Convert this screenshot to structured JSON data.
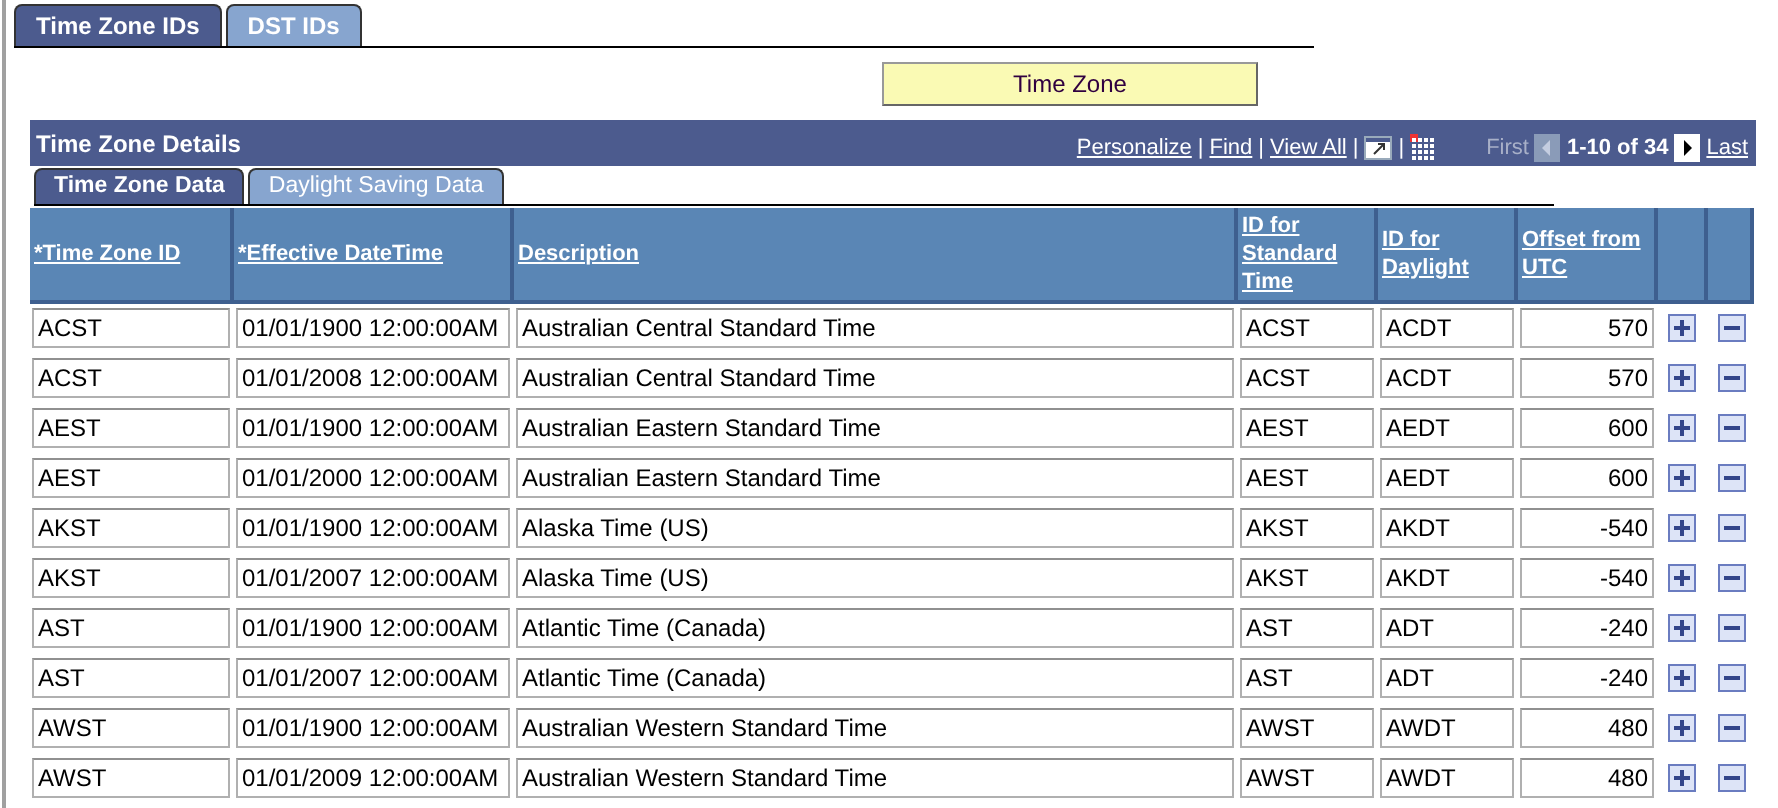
{
  "tabs": [
    {
      "label": "Time Zone IDs",
      "selected": true
    },
    {
      "label": "DST IDs",
      "selected": false
    }
  ],
  "action_button": {
    "label": "Time Zone"
  },
  "section": {
    "title": "Time Zone Details",
    "links": [
      {
        "kind": "link",
        "text": "Personalize"
      },
      {
        "kind": "separator",
        "text": "|"
      },
      {
        "kind": "link",
        "text": "Find"
      },
      {
        "kind": "separator",
        "text": "|"
      },
      {
        "kind": "link",
        "text": "View All"
      },
      {
        "kind": "separator",
        "text": "|"
      },
      {
        "kind": "new-window"
      },
      {
        "kind": "separator",
        "text": "|"
      },
      {
        "kind": "grid"
      }
    ],
    "first": "First",
    "range": "1-10 of 34",
    "last": "Last",
    "prev_disabled": true
  },
  "subtabs": [
    {
      "label": "Time Zone Data",
      "selected": true
    },
    {
      "label": "Daylight Saving Data",
      "selected": false
    }
  ],
  "table": {
    "columns": [
      "*Time Zone ID",
      "*Effective DateTime",
      "Description",
      "ID for Standard Time",
      "ID for Daylight",
      "Offset from UTC"
    ],
    "rows": [
      [
        "ACST",
        "01/01/1900 12:00:00AM",
        "Australian Central Standard Time",
        "ACST",
        "ACDT",
        "570"
      ],
      [
        "ACST",
        "01/01/2008 12:00:00AM",
        "Australian Central Standard Time",
        "ACST",
        "ACDT",
        "570"
      ],
      [
        "AEST",
        "01/01/1900 12:00:00AM",
        "Australian Eastern Standard Time",
        "AEST",
        "AEDT",
        "600"
      ],
      [
        "AEST",
        "01/01/2000 12:00:00AM",
        "Australian Eastern Standard Time",
        "AEST",
        "AEDT",
        "600"
      ],
      [
        "AKST",
        "01/01/1900 12:00:00AM",
        "Alaska Time (US)",
        "AKST",
        "AKDT",
        "-540"
      ],
      [
        "AKST",
        "01/01/2007 12:00:00AM",
        "Alaska Time (US)",
        "AKST",
        "AKDT",
        "-540"
      ],
      [
        "AST",
        "01/01/1900 12:00:00AM",
        "Atlantic Time (Canada)",
        "AST",
        "ADT",
        "-240"
      ],
      [
        "AST",
        "01/01/2007 12:00:00AM",
        "Atlantic Time (Canada)",
        "AST",
        "ADT",
        "-240"
      ],
      [
        "AWST",
        "01/01/1900 12:00:00AM",
        "Australian Western Standard Time",
        "AWST",
        "AWDT",
        "480"
      ],
      [
        "AWST",
        "01/01/2009 12:00:00AM",
        "Australian Western Standard Time",
        "AWST",
        "AWDT",
        "480"
      ]
    ]
  }
}
